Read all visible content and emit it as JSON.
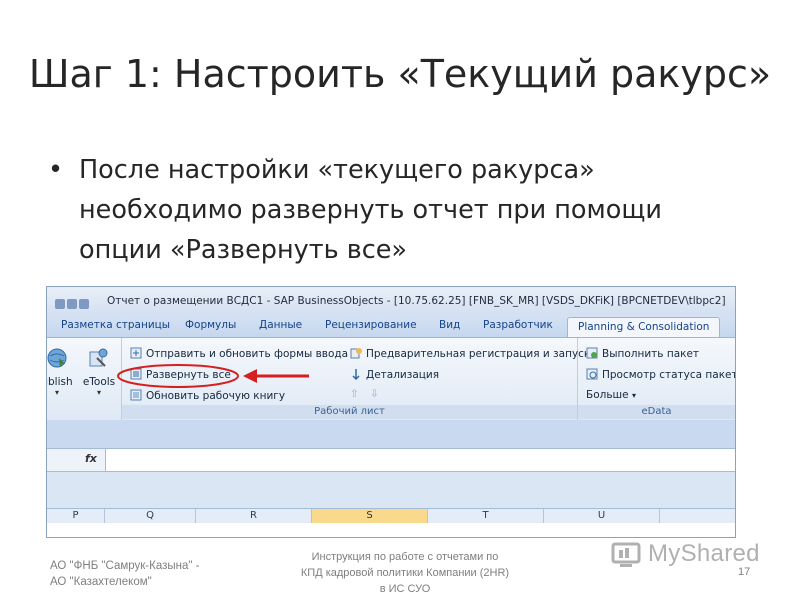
{
  "slide": {
    "title": "Шаг 1: Настроить «Текущий ракурс»",
    "bullet_marker": "•",
    "bullet_lines": [
      "После настройки «текущего ракурса»",
      "необходимо развернуть отчет при помощи",
      "опции «Развернуть все»"
    ]
  },
  "window": {
    "title": "Отчет о размещении ВСДС1 - SAP BusinessObjects - [10.75.62.25] [FNB_SK_MR] [VSDS_DKFiK] [BPCNETDEV\\tlbpc2]"
  },
  "ribbon_tabs": [
    "Разметка страницы",
    "Формулы",
    "Данные",
    "Рецензирование",
    "Вид",
    "Разработчик",
    "Planning & Consolidation"
  ],
  "ribbon": {
    "publish_label": "ublish",
    "etools_label": "eTools",
    "group1_items": [
      "Отправить и обновить формы ввода",
      "Развернуть все",
      "Обновить рабочую книгу"
    ],
    "group2_items": [
      "Предварительная регистрация и запуск",
      "Детализация"
    ],
    "group_label_main": "Рабочий лист",
    "group3_items": [
      "Выполнить пакет",
      "Просмотр статуса пакета",
      "Больше"
    ],
    "group_label_edata": "eData"
  },
  "formula_bar": {
    "fx": "fx"
  },
  "columns": [
    "P",
    "Q",
    "R",
    "S",
    "T",
    "U"
  ],
  "selected_column": "S",
  "footer": {
    "left_lines": [
      "АО \"ФНБ \"Самрук-Казына\" -",
      "АО \"Казахтелеком\""
    ],
    "center_lines": [
      "Инструкция по работе с отчетами по",
      "КПД кадровой политики Компании (2HR)",
      "в ИС СУО"
    ],
    "page_number": "17",
    "watermark_text": "MyShared"
  },
  "colors": {
    "highlight_circle": "#d42020",
    "arrow": "#d42020",
    "selected_column_bg": "#f9d98b",
    "ribbon_tab_text": "#15428b"
  }
}
